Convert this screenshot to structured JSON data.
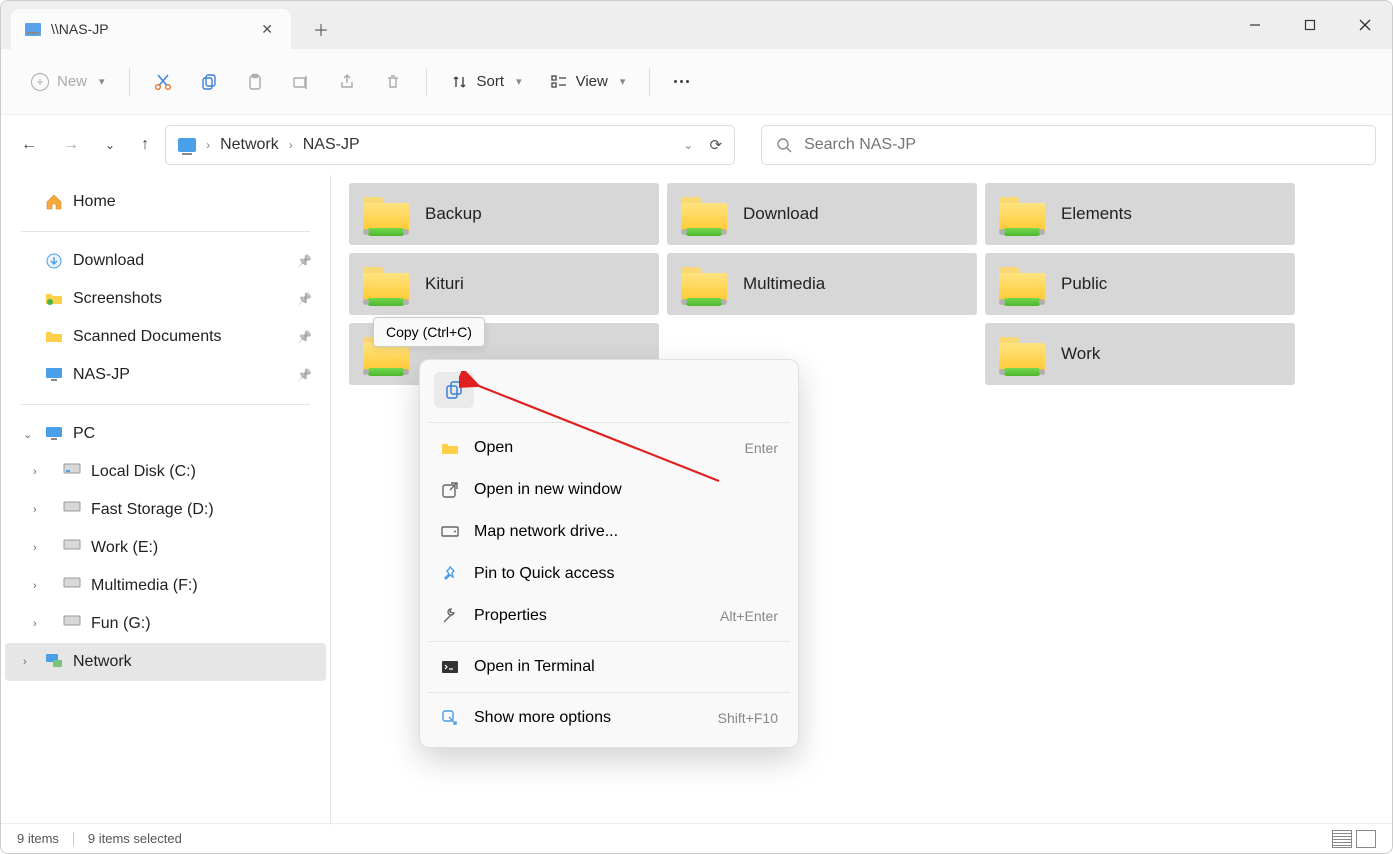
{
  "tab": {
    "title": "\\\\NAS-JP"
  },
  "toolbar": {
    "new": "New",
    "sort": "Sort",
    "view": "View"
  },
  "breadcrumb": {
    "root": "Network",
    "current": "NAS-JP"
  },
  "search": {
    "placeholder": "Search NAS-JP"
  },
  "sidebar": {
    "home": "Home",
    "quick": [
      "Download",
      "Screenshots",
      "Scanned Documents",
      "NAS-JP"
    ],
    "pc": "PC",
    "drives": [
      "Local Disk (C:)",
      "Fast Storage (D:)",
      "Work (E:)",
      "Multimedia (F:)",
      "Fun (G:)"
    ],
    "network": "Network"
  },
  "folders": [
    "Backup",
    "Download",
    "Elements",
    "Kituri",
    "Multimedia",
    "Public",
    "",
    "",
    "Work"
  ],
  "tooltip": "Copy (Ctrl+C)",
  "context_menu": {
    "open": "Open",
    "open_shortcut": "Enter",
    "open_new_window": "Open in new window",
    "map_drive": "Map network drive...",
    "pin": "Pin to Quick access",
    "properties": "Properties",
    "properties_shortcut": "Alt+Enter",
    "terminal": "Open in Terminal",
    "more": "Show more options",
    "more_shortcut": "Shift+F10"
  },
  "status": {
    "items": "9 items",
    "selected": "9 items selected"
  }
}
